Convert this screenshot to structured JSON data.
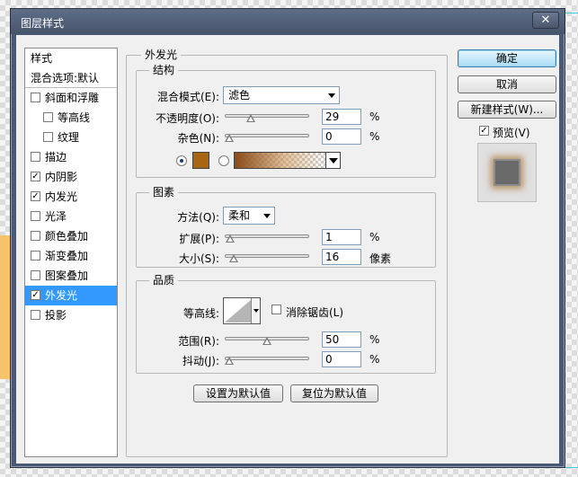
{
  "window": {
    "title": "图层样式",
    "close_label": "✕"
  },
  "style_list": {
    "header": "样式",
    "blend_options": "混合选项:默认",
    "items": [
      {
        "label": "斜面和浮雕",
        "checked": false,
        "indent": false
      },
      {
        "label": "等高线",
        "checked": false,
        "indent": true
      },
      {
        "label": "纹理",
        "checked": false,
        "indent": true
      },
      {
        "label": "描边",
        "checked": false,
        "indent": false
      },
      {
        "label": "内阴影",
        "checked": true,
        "indent": false
      },
      {
        "label": "内发光",
        "checked": true,
        "indent": false
      },
      {
        "label": "光泽",
        "checked": false,
        "indent": false
      },
      {
        "label": "颜色叠加",
        "checked": false,
        "indent": false
      },
      {
        "label": "渐变叠加",
        "checked": false,
        "indent": false
      },
      {
        "label": "图案叠加",
        "checked": false,
        "indent": false
      },
      {
        "label": "外发光",
        "checked": true,
        "indent": false,
        "selected": true
      },
      {
        "label": "投影",
        "checked": false,
        "indent": false
      }
    ]
  },
  "panel": {
    "title": "外发光",
    "structure": {
      "legend": "结构",
      "blend_mode_label": "混合模式(E):",
      "blend_mode_value": "滤色",
      "opacity_label": "不透明度(O):",
      "opacity_value": "29",
      "opacity_fraction": 0.29,
      "noise_label": "杂色(N):",
      "noise_value": "0",
      "noise_fraction": 0,
      "percent": "%",
      "color_mode": "solid",
      "glow_color": "#a86512"
    },
    "elements": {
      "legend": "图素",
      "technique_label": "方法(Q):",
      "technique_value": "柔和",
      "spread_label": "扩展(P):",
      "spread_value": "1",
      "spread_fraction": 0.01,
      "size_label": "大小(S):",
      "size_value": "16",
      "size_fraction": 0.064,
      "percent": "%",
      "pixels": "像素"
    },
    "quality": {
      "legend": "品质",
      "contour_label": "等高线:",
      "antialias_label": "消除锯齿(L)",
      "antialias_checked": false,
      "range_label": "范围(R):",
      "range_value": "50",
      "range_fraction": 0.5,
      "jitter_label": "抖动(J):",
      "jitter_value": "0",
      "jitter_fraction": 0,
      "percent": "%"
    },
    "make_default": "设置为默认值",
    "reset_default": "复位为默认值"
  },
  "buttons": {
    "ok": "确定",
    "cancel": "取消",
    "new_style": "新建样式(W)...",
    "preview_label": "预览(V)",
    "preview_checked": true
  }
}
